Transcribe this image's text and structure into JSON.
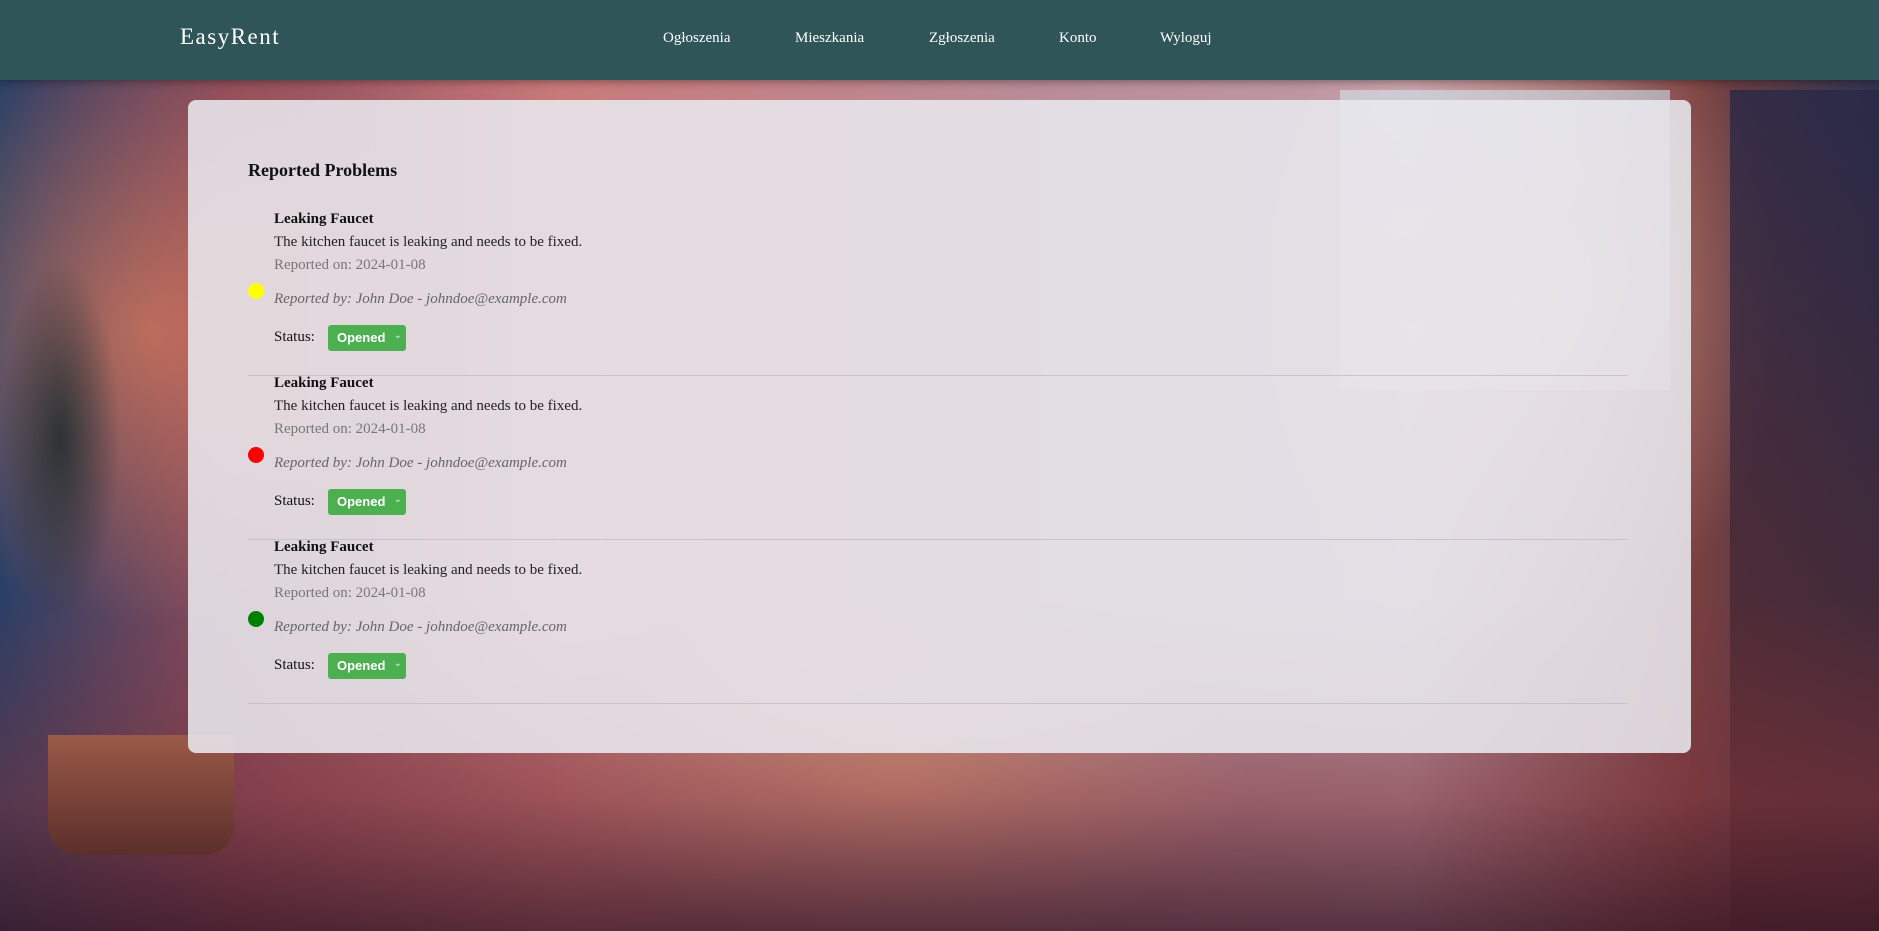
{
  "navbar": {
    "brand": "EasyRent",
    "links": [
      "Ogłoszenia",
      "Mieszkania",
      "Zgłoszenia",
      "Konto",
      "Wyloguj"
    ]
  },
  "panel": {
    "title": "Reported Problems",
    "status_label": "Status:",
    "problems": [
      {
        "title": "Leaking Faucet",
        "description": "The kitchen faucet is leaking and needs to be fixed.",
        "reported_on": "Reported on: 2024-01-08",
        "reported_by": "Reported by: John Doe - johndoe@example.com",
        "status": "Opened",
        "priority_color": "#ffff00"
      },
      {
        "title": "Leaking Faucet",
        "description": "The kitchen faucet is leaking and needs to be fixed.",
        "reported_on": "Reported on: 2024-01-08",
        "reported_by": "Reported by: John Doe - johndoe@example.com",
        "status": "Opened",
        "priority_color": "#ff0000"
      },
      {
        "title": "Leaking Faucet",
        "description": "The kitchen faucet is leaking and needs to be fixed.",
        "reported_on": "Reported on: 2024-01-08",
        "reported_by": "Reported by: John Doe - johndoe@example.com",
        "status": "Opened",
        "priority_color": "#008000"
      }
    ]
  },
  "colors": {
    "navbar": "#2f5558",
    "status_opened": "#4caf50"
  },
  "icons": {
    "status_dropdown": "chevron-down-icon"
  }
}
